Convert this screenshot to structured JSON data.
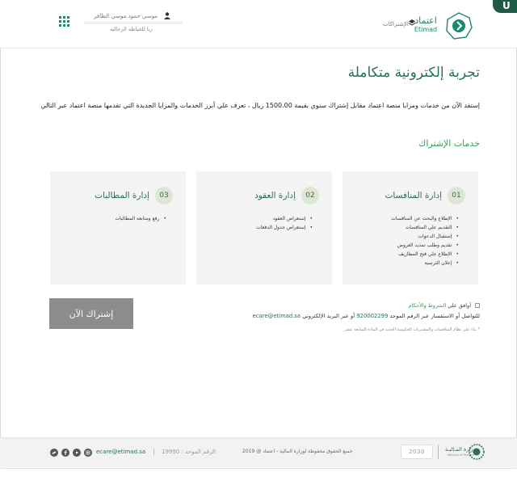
{
  "header": {
    "logo_ar": "اعتماد",
    "logo_en": "Etimad",
    "subscriptions_link": "الإشتراكات",
    "user_name": "موسي حمود موسي الظافر",
    "user_org": "زيا للخياطه الرجاليه",
    "corner_badge": "U"
  },
  "main": {
    "page_title": "تجربة إلكترونية متكاملة",
    "intro": "إستفد الآن من خدمات ومزايا منصة اعتماد مقابل إشتراك سنوي بقيمة 1500.00 ريال ، تعرف علي أبرز الخدمات والمزايا الجديدة التي تقدمها منصة اعتماد عبر التالي",
    "services_title": "خدمات الإشتراك",
    "cards": [
      {
        "number": "01",
        "title": "إدارة المنافسات",
        "items": [
          "الإطلاع والبحث عن المنافسات",
          "التقديم علي المنافسات",
          "إستقبال الدعوات",
          "تقديم وطلب تمديد العروض",
          "الإطلاع علي فتح المظاريف",
          "إعلان الترسية"
        ]
      },
      {
        "number": "02",
        "title": "إدارة العقود",
        "items": [
          "إستعراض العقود",
          "إستعراض جدول الدفعات"
        ]
      },
      {
        "number": "03",
        "title": "إدارة المطالبات",
        "items": [
          "رفع ومتابعة المطالبات"
        ]
      }
    ],
    "subscribe_button": "إشتراك الآن",
    "terms_prefix": "أوافق علي",
    "terms_link": "الشروط والأحكام",
    "contact_prefix": "للتواصل أو الاستفسار عبر الرقم الموحد",
    "contact_phone": "920002299",
    "contact_middle": "أو عبر البريد الإلكتروني",
    "contact_email": "ecare@etimad.sa",
    "note": "* بناء علي نظام المنافسات والمشتريات الحكومية الجديد في المادة السابعة عشر"
  },
  "footer": {
    "email": "ecare@etimad.sa",
    "separator": "|",
    "phone": "الرقم الموحد : 19990",
    "copyright": "جميع الحقوق محفوظة لوزارة المالية - اعتماد @ 2019",
    "vision": "2030",
    "ministry_ar": "وزارة المـاليـة",
    "ministry_en": "Ministry of Finance",
    "social_icons": [
      "instagram-icon",
      "youtube-icon",
      "facebook-icon",
      "twitter-icon"
    ]
  },
  "colors": {
    "accent": "#2b6f5a",
    "green": "#2ea64e",
    "button": "#8c8c8c"
  }
}
